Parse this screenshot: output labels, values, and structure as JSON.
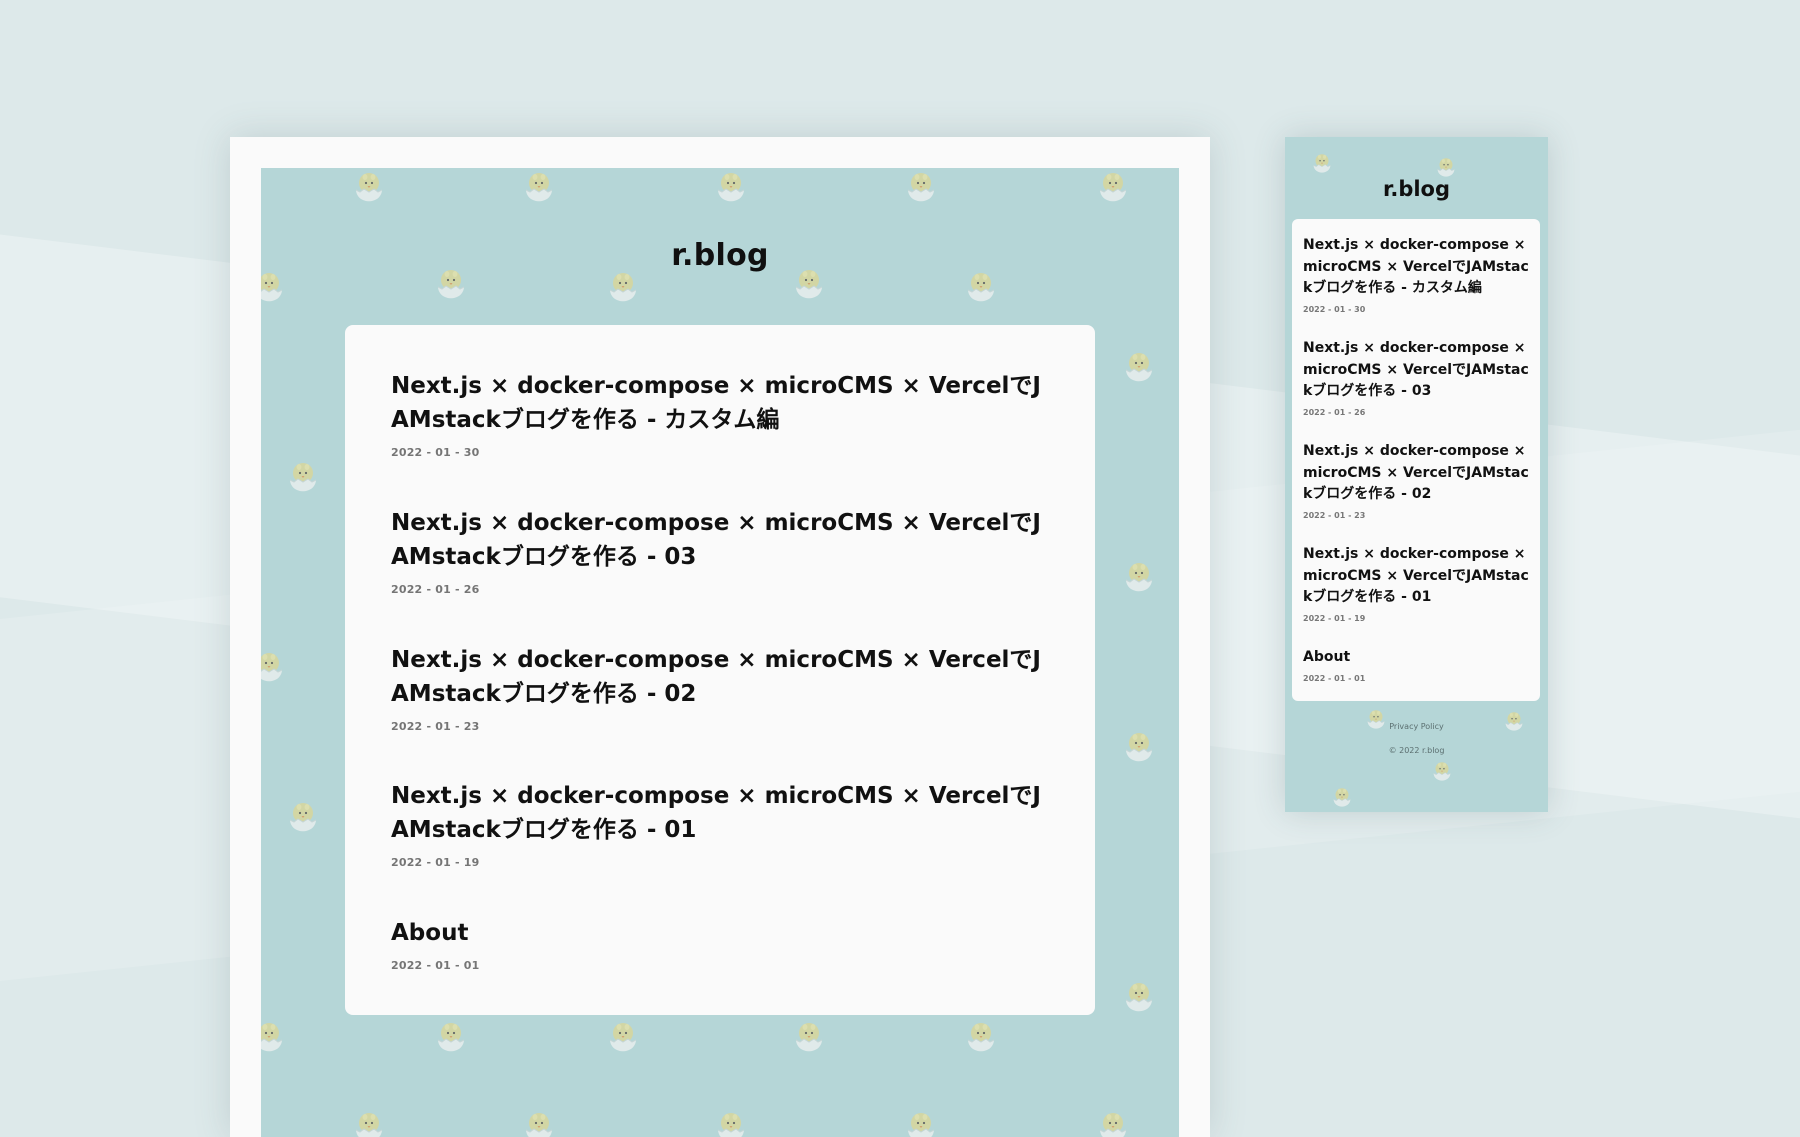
{
  "site": {
    "title": "r.blog"
  },
  "posts": [
    {
      "title": "Next.js × docker-compose × microCMS × VercelでJAMstackブログを作る - カスタム編",
      "date": "2022 - 01 - 30"
    },
    {
      "title": "Next.js × docker-compose × microCMS × VercelでJAMstackブログを作る - 03",
      "date": "2022 - 01 - 26"
    },
    {
      "title": "Next.js × docker-compose × microCMS × VercelでJAMstackブログを作る - 02",
      "date": "2022 - 01 - 23"
    },
    {
      "title": "Next.js × docker-compose × microCMS × VercelでJAMstackブログを作る - 01",
      "date": "2022 - 01 - 19"
    },
    {
      "title": "About",
      "date": "2022 - 01 - 01"
    }
  ],
  "footer": {
    "privacy_label": "Privacy Policy",
    "copyright": "© 2022 r.blog"
  },
  "colors": {
    "page_background": "#dde9ea",
    "site_background": "#b5d6d7",
    "card_background": "#fafafa",
    "text": "#111111",
    "date_text": "#757575"
  },
  "icons": {
    "pattern": "chick-in-egg-icon"
  }
}
